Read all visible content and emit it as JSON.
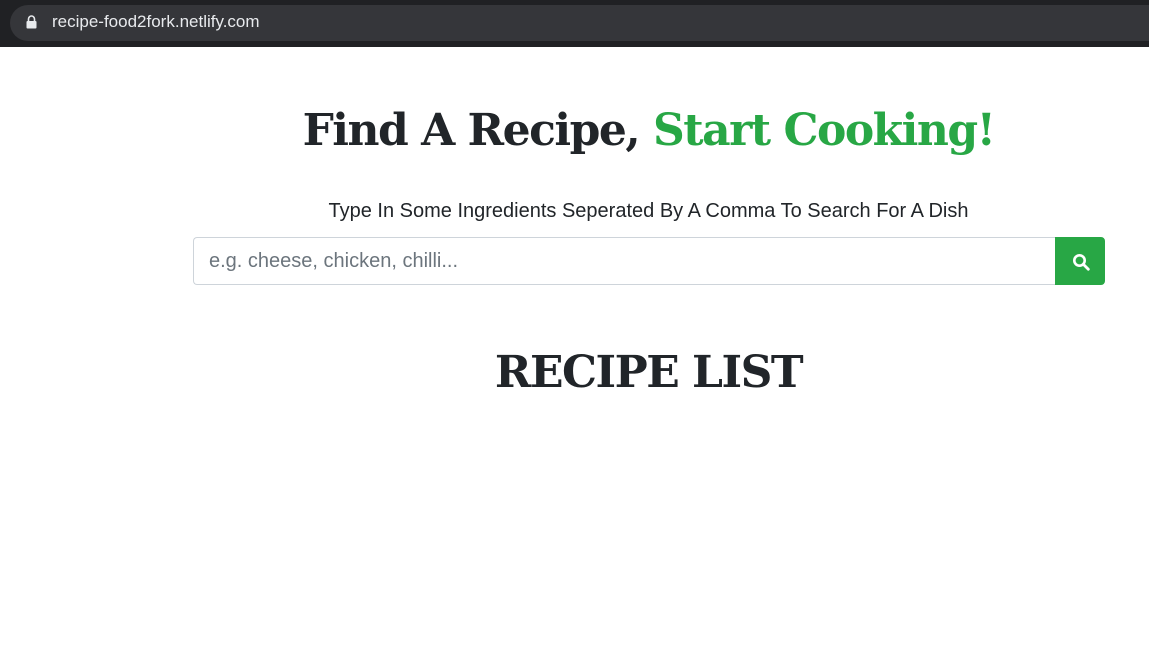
{
  "browser": {
    "url": "recipe-food2fork.netlify.com",
    "lock_icon": "lock-icon"
  },
  "header": {
    "title_part1": "Find A Recipe, ",
    "title_part2": "Start Cooking!",
    "subtitle": "Type In Some Ingredients Seperated By A Comma To Search For A Dish"
  },
  "search": {
    "placeholder": "e.g. cheese, chicken, chilli...",
    "value": "",
    "button_icon": "search-icon"
  },
  "recipes": {
    "title": "RECIPE LIST",
    "items": []
  },
  "colors": {
    "accent": "#28a745",
    "text": "#212529",
    "browser_bar": "#202124",
    "url_pill": "#35363a"
  }
}
